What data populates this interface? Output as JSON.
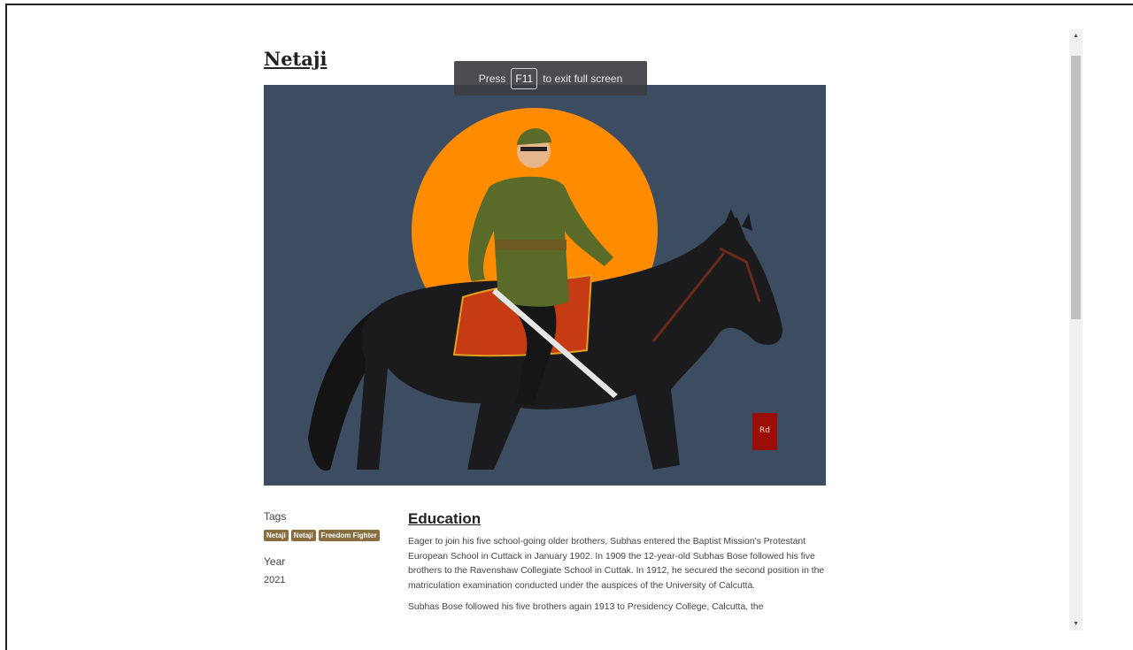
{
  "page": {
    "title": "Netaji"
  },
  "fullscreen_notice": {
    "before": "Press",
    "key": "F11",
    "after": "to exit full screen"
  },
  "hero_image": {
    "background_color": "#3c4d62",
    "sun_color": "#ff8c00",
    "signature": "Rd\n₹₹"
  },
  "sidebar": {
    "tags_label": "Tags",
    "tags": [
      "Netaji",
      "Netaji",
      "Freedom Fighter"
    ],
    "year_label": "Year",
    "year_value": "2021"
  },
  "article": {
    "heading": "Education",
    "paragraphs": [
      "Eager to join his five school-going older brothers, Subhas entered the Baptist Mission's Protestant European School in Cuttack in January 1902. In 1909 the 12-year-old Subhas Bose followed his five brothers to the Ravenshaw Collegiate School in Cuttak. In 1912, he secured the second position in the matriculation examination conducted under the auspices of the University of Calcutta.",
      "Subhas Bose followed his five brothers again 1913 to Presidency College, Calcutta, the"
    ]
  },
  "colors": {
    "tag_bg": "#8a6d3e",
    "scrollbar_thumb": "#c1c1c1"
  }
}
